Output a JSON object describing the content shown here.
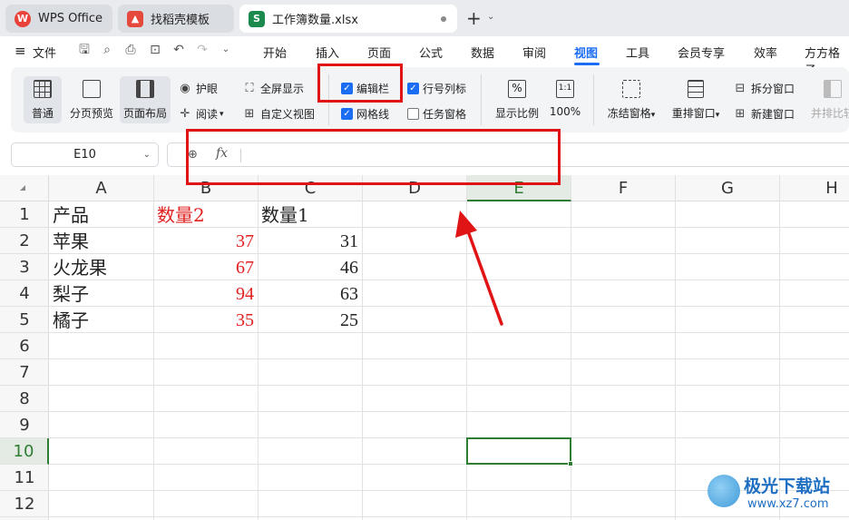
{
  "tabs": [
    {
      "label": "WPS Office"
    },
    {
      "label": "找稻壳模板"
    },
    {
      "label": "工作簿数量.xlsx"
    }
  ],
  "menu": {
    "file": "文件",
    "items": [
      "开始",
      "插入",
      "页面",
      "公式",
      "数据",
      "审阅",
      "视图",
      "工具",
      "会员专享",
      "效率",
      "方方格子"
    ],
    "active": "视图"
  },
  "ribbon": {
    "normal": "普通",
    "page_break_preview": "分页预览",
    "page_layout": "页面布局",
    "eye_protect": "护眼",
    "reading": "阅读",
    "fullscreen": "全屏显示",
    "custom_view": "自定义视图",
    "edit_bar": "编辑栏",
    "gridlines": "网格线",
    "row_col_headers": "行号列标",
    "task_pane": "任务窗格",
    "zoom_ratio": "显示比例",
    "zoom_100": "100%",
    "freeze": "冻结窗格",
    "arrange": "重排窗口",
    "split": "拆分窗口",
    "new_window": "新建窗口",
    "side_by_side": "并排比较",
    "checks": {
      "edit_bar": true,
      "gridlines": true,
      "row_col_headers": true,
      "task_pane": false
    }
  },
  "formula_bar": {
    "name_box": "E10",
    "fx": "fx",
    "value": ""
  },
  "columns": [
    "A",
    "B",
    "C",
    "D",
    "E",
    "F",
    "G",
    "H"
  ],
  "rows": [
    "1",
    "2",
    "3",
    "4",
    "5",
    "6",
    "7",
    "8",
    "9",
    "10",
    "11",
    "12"
  ],
  "active_cell": {
    "col": "E",
    "row": "10"
  },
  "sheet": {
    "r1": {
      "a": "产品",
      "b": "数量2",
      "c": "数量1"
    },
    "r2": {
      "a": "苹果",
      "b": "37",
      "c": "31"
    },
    "r3": {
      "a": "火龙果",
      "b": "67",
      "c": "46"
    },
    "r4": {
      "a": "梨子",
      "b": "94",
      "c": "63"
    },
    "r5": {
      "a": "橘子",
      "b": "35",
      "c": "25"
    }
  },
  "colors": {
    "accent": "#1b6ef3",
    "annotation": "#e01414",
    "selection": "#2e7d32",
    "highlight_text": "#e02020"
  },
  "watermark": {
    "name": "极光下载站",
    "url": "www.xz7.com"
  }
}
